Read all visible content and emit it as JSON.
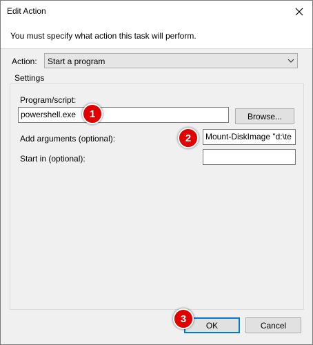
{
  "window": {
    "title": "Edit Action",
    "close_icon": "close-icon"
  },
  "message": "You must specify what action this task will perform.",
  "action": {
    "label": "Action:",
    "value": "Start a program"
  },
  "settings": {
    "legend": "Settings",
    "program_label": "Program/script:",
    "program_value": "powershell.exe",
    "browse_label": "Browse...",
    "arguments_label": "Add arguments (optional):",
    "arguments_value": "Mount-DiskImage \"d:\\te",
    "start_in_label": "Start in (optional):",
    "start_in_value": ""
  },
  "buttons": {
    "ok": "OK",
    "cancel": "Cancel"
  },
  "annotations": {
    "badge1": "1",
    "badge2": "2",
    "badge3": "3"
  },
  "colors": {
    "badge": "#e00000",
    "focus": "#0078d7",
    "dialog_bg": "#f0f0f0"
  }
}
